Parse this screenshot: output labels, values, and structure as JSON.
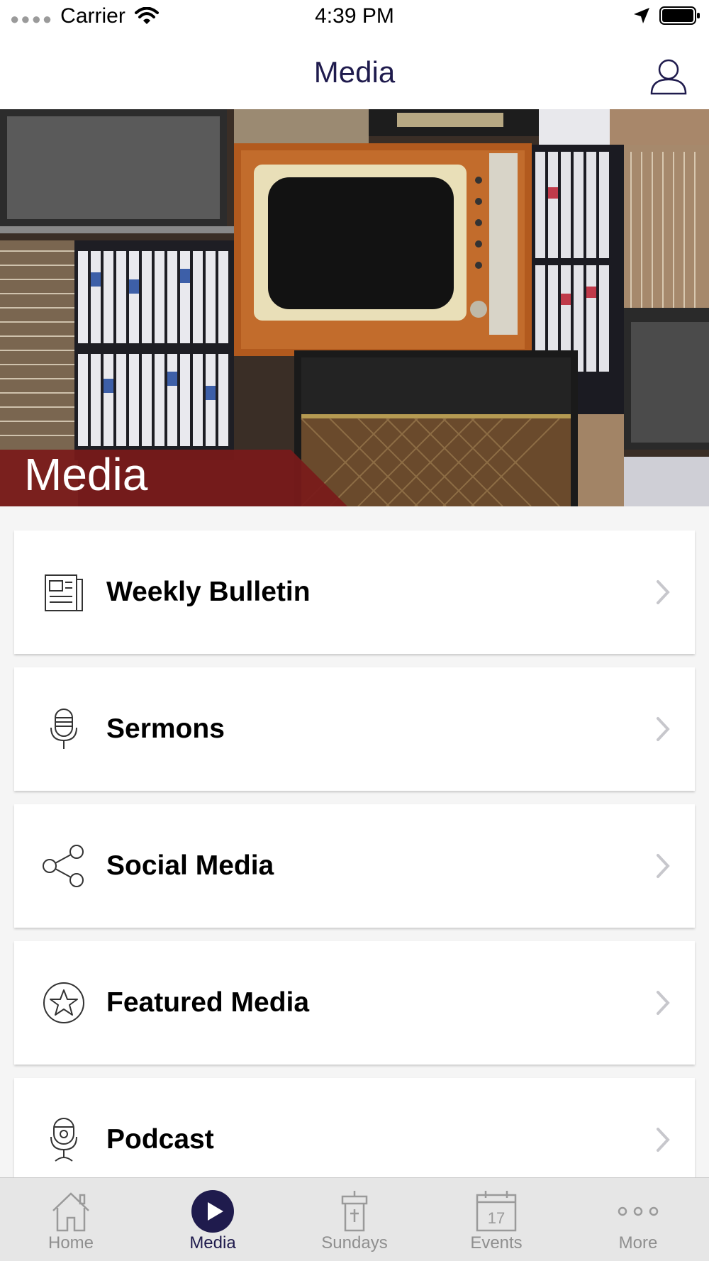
{
  "status_bar": {
    "carrier": "Carrier",
    "time": "4:39 PM"
  },
  "nav": {
    "title": "Media"
  },
  "hero": {
    "caption": "Media"
  },
  "list": [
    {
      "label": "Weekly Bulletin",
      "icon": "newspaper-icon"
    },
    {
      "label": "Sermons",
      "icon": "microphone-icon"
    },
    {
      "label": "Social Media",
      "icon": "share-icon"
    },
    {
      "label": "Featured Media",
      "icon": "star-icon"
    },
    {
      "label": "Podcast",
      "icon": "podcast-icon"
    }
  ],
  "tabs": [
    {
      "label": "Home",
      "icon": "home-icon",
      "active": false
    },
    {
      "label": "Media",
      "icon": "play-icon",
      "active": true
    },
    {
      "label": "Sundays",
      "icon": "pulpit-icon",
      "active": false
    },
    {
      "label": "Events",
      "icon": "calendar-icon",
      "active": false,
      "calendar_day": "17"
    },
    {
      "label": "More",
      "icon": "more-icon",
      "active": false
    }
  ],
  "colors": {
    "accent": "#1f1b4d",
    "hero_banner": "#7a1a1a",
    "inactive": "#8f8f8f"
  }
}
